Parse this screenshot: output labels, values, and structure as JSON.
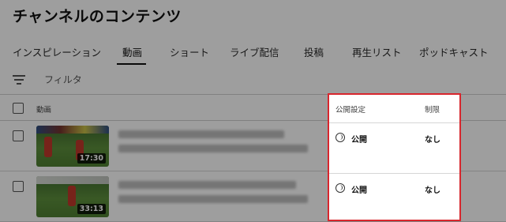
{
  "page": {
    "title": "チャンネルのコンテンツ"
  },
  "tabs": [
    {
      "label": "インスピレーション"
    },
    {
      "label": "動画"
    },
    {
      "label": "ショート"
    },
    {
      "label": "ライブ配信"
    },
    {
      "label": "投稿"
    },
    {
      "label": "再生リスト"
    },
    {
      "label": "ポッドキャスト"
    }
  ],
  "active_tab": "動画",
  "filter": {
    "placeholder": "フィルタ"
  },
  "table": {
    "headers": {
      "video": "動画",
      "visibility": "公開設定",
      "restrictions": "制限"
    },
    "rows": [
      {
        "duration": "17:30",
        "visibility": "公開",
        "restrictions": "なし"
      },
      {
        "duration": "33:13",
        "visibility": "公開",
        "restrictions": "なし"
      }
    ]
  },
  "colors": {
    "highlight_border": "#d8262d",
    "overlay": "rgba(0,0,0,0.38)"
  },
  "icons": {
    "filter": "filter-lines-icon",
    "visibility": "globe-icon"
  }
}
